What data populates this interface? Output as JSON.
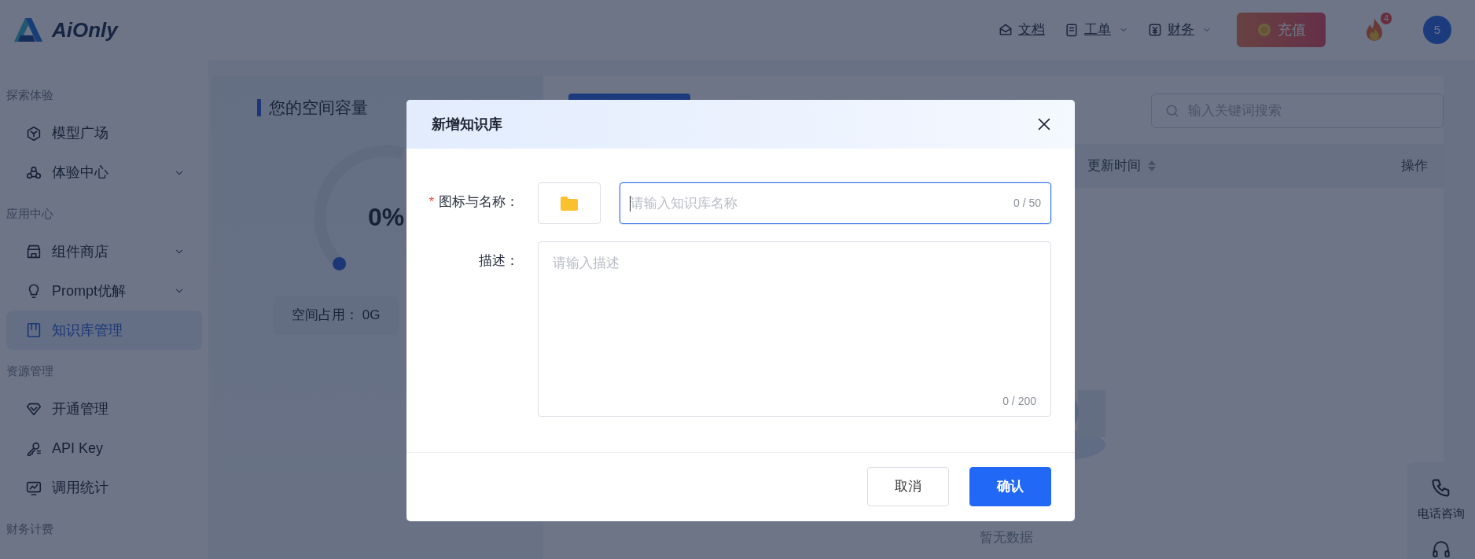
{
  "header": {
    "logo": "AiOnly",
    "nav": [
      {
        "label": "文档",
        "dropdown": false
      },
      {
        "label": "工单",
        "dropdown": true
      },
      {
        "label": "财务",
        "dropdown": true
      }
    ],
    "recharge_button": "充值",
    "notification_count": "4",
    "avatar": "5"
  },
  "sidebar": {
    "groups": [
      {
        "title": "探索体验",
        "items": [
          {
            "label": "模型广场",
            "selected": false
          },
          {
            "label": "体验中心",
            "selected": false,
            "expanded": false
          }
        ]
      },
      {
        "title": "应用中心",
        "items": [
          {
            "label": "组件商店",
            "selected": false,
            "expanded": false
          },
          {
            "label": "Prompt优解",
            "selected": false,
            "expanded": false
          },
          {
            "label": "知识库管理",
            "selected": true
          }
        ]
      },
      {
        "title": "资源管理",
        "items": [
          {
            "label": "开通管理",
            "selected": false
          },
          {
            "label": "API Key",
            "selected": false
          },
          {
            "label": "调用统计",
            "selected": false
          }
        ]
      },
      {
        "title": "财务计费"
      }
    ]
  },
  "storage": {
    "title": "您的空间容量",
    "percent": "0%",
    "usage": "空间占用： 0G"
  },
  "knowledge": {
    "search": {
      "placeholder": "输入关键词搜索"
    },
    "table": {
      "columns": [
        {
          "label": "更新时间",
          "sortable": true
        },
        {
          "label": "操作",
          "sortable": false
        }
      ]
    },
    "empty_text": "暂无数据"
  },
  "floating": {
    "items": [
      "电话咨询"
    ]
  },
  "dialog": {
    "title": "新增知识库",
    "fields": [
      {
        "kind": "icon_name",
        "label": "图标与名称：",
        "required_mark": "*",
        "placeholder": "请输入知识库名称",
        "counter": "0 / 50",
        "focused": true
      },
      {
        "kind": "textarea",
        "label": "描述：",
        "placeholder": "请输入描述",
        "counter": "0 / 200",
        "focused": false
      }
    ],
    "buttons": [
      {
        "label": "取消",
        "primary": false
      },
      {
        "label": "确认",
        "primary": true
      }
    ]
  }
}
